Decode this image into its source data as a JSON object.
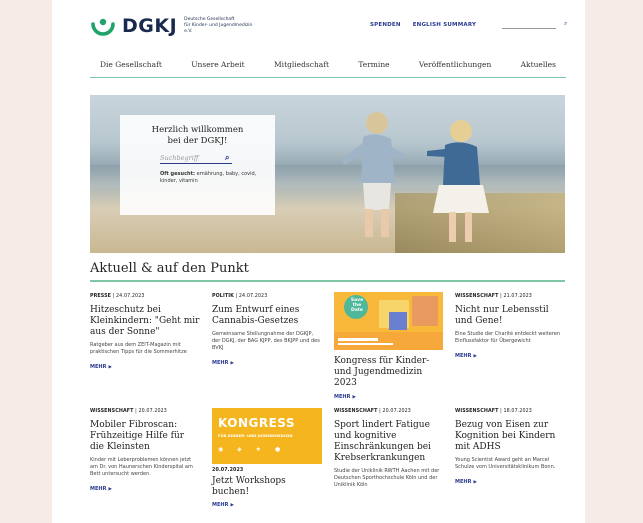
{
  "header": {
    "logo_word": "DGKJ",
    "logo_sub_1": "Deutsche Gesellschaft",
    "logo_sub_2": "für Kinder- und Jugendmedizin e.V.",
    "links": [
      "SPENDEN",
      "ENGLISH SUMMARY"
    ],
    "search_icon": "search-icon"
  },
  "nav": [
    "Die Gesellschaft",
    "Unsere Arbeit",
    "Mitgliedschaft",
    "Termine",
    "Veröffentlichungen",
    "Aktuelles"
  ],
  "hero": {
    "welcome_line1": "Herzlich willkommen",
    "welcome_line2": "bei der DGKJ!",
    "search_placeholder": "Suchbegriff",
    "oft_label": "Oft gesucht:",
    "oft_text": " ernährung, baby, covid, kinder, vitamin"
  },
  "section_title": "Aktuell & auf den Punkt",
  "more_label": "MEHR",
  "cards": [
    {
      "cat": "PRESSE",
      "date": "24.07.2023",
      "title": "Hitzeschutz bei Kleinkindern: \"Geht mir aus der Sonne\"",
      "desc": "Ratgeber aus dem ZEIT-Magazin mit praktischen Tipps für die Sommerhitze"
    },
    {
      "cat": "POLITIK",
      "date": "24.07.2023",
      "title": "Zum Entwurf eines Cannabis-Gesetzes",
      "desc": "Gemeinsame Stellungnahme der DGKJP, der DGKJ, der BAG KJPP, des BKJPP und des BVKJ"
    },
    {
      "cat": "",
      "date": "",
      "title": "Kongress für Kinder- und Jugendmedizin 2023",
      "desc": ""
    },
    {
      "cat": "WISSENSCHAFT",
      "date": "21.07.2023",
      "title": "Nicht nur Lebensstil und Gene!",
      "desc": "Eine Studie der Charité entdeckt weiteren Einflussfaktor für Übergewicht"
    },
    {
      "cat": "WISSENSCHAFT",
      "date": "20.07.2023",
      "title": "Mobiler Fibroscan: Frühzeitige Hilfe für die Kleinsten",
      "desc": "Kinder mit Leberproblemen können jetzt am Dr. von Haunerschen Kinderspital am Bett untersucht werden."
    },
    {
      "cat": "",
      "date": "20.07.2023",
      "title": "Jetzt Workshops buchen!",
      "desc": ""
    },
    {
      "cat": "WISSENSCHAFT",
      "date": "20.07.2023",
      "title": "Sport lindert Fatigue und kognitive Einschränkungen bei Krebserkrankungen",
      "desc": "Studie der Uniklinik RWTH Aachen mit der Deutschen Sporthochschule Köln und der Uniklinik Köln"
    },
    {
      "cat": "WISSENSCHAFT",
      "date": "18.07.2023",
      "title": "Bezug von Eisen zur Kognition bei Kindern mit ADHS",
      "desc": "Young Scientist Award geht an Marcel Schulze vom Universitätsklinikum Bonn."
    }
  ],
  "kongress_banner": {
    "title": "KONGRESS",
    "sub": "FÜR KINDER- UND JUGENDMEDIZIN"
  },
  "save_date": {
    "line1": "Save",
    "line2": "the",
    "line3": "Date"
  },
  "colors": {
    "accent_green": "#7fc7a6",
    "link_blue": "#2a3a8f",
    "banner_yellow": "#f4b51f"
  }
}
